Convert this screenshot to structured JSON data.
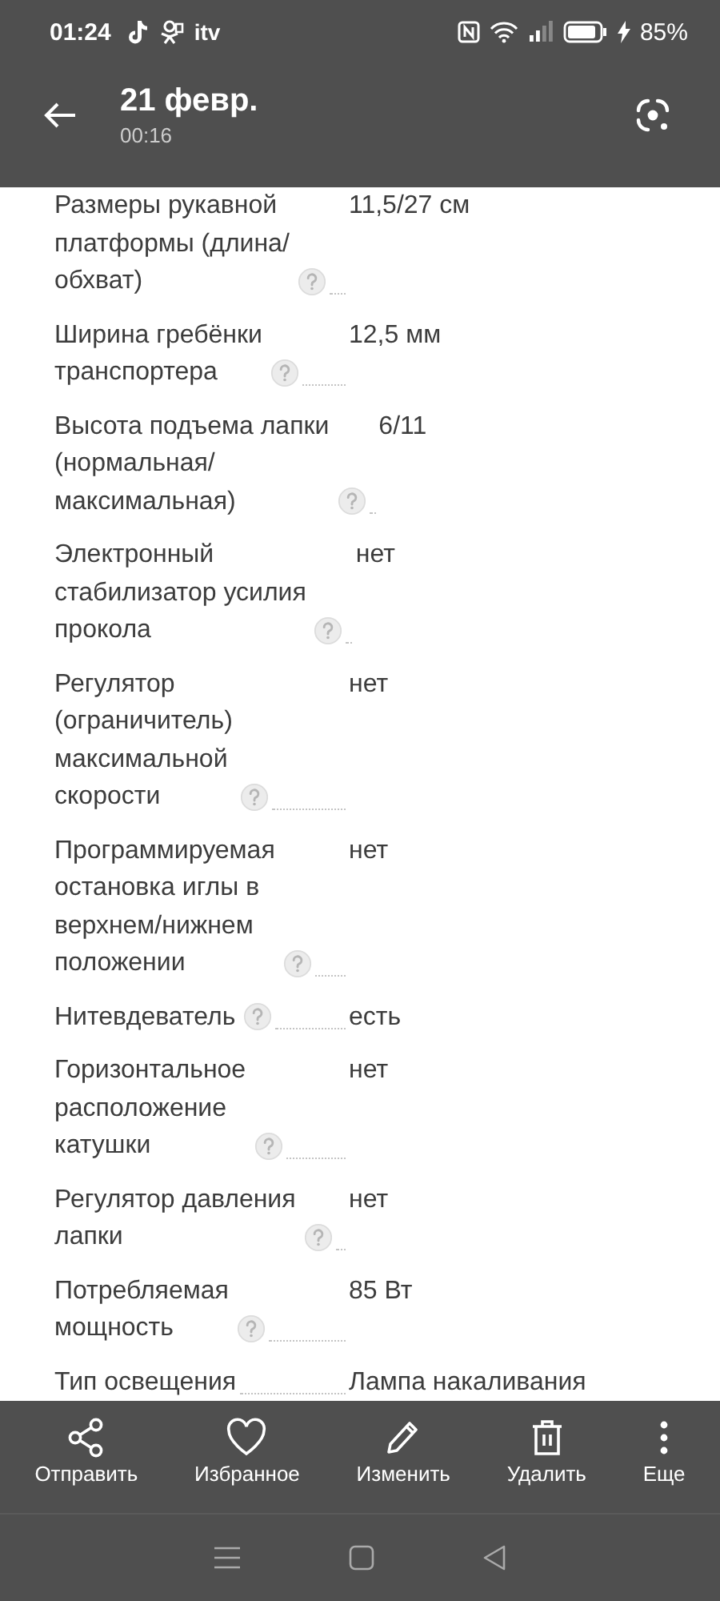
{
  "status_bar": {
    "time": "01:24",
    "app_label": "itv",
    "battery": "85%"
  },
  "toolbar": {
    "title": "21 февр.",
    "subtitle": "00:16"
  },
  "specs": [
    {
      "label": "Размеры рукавной\nплатформы (длина/\nобхват)",
      "help": true,
      "value": "11,5/27 см"
    },
    {
      "label": "Ширина гребёнки\nтранспортера",
      "help": true,
      "value": "12,5 мм"
    },
    {
      "label": "Высота подъема лапки\n(нормальная/\nмаксимальная)",
      "help": true,
      "value": "6/11"
    },
    {
      "label": "Электронный\nстабилизатор усилия\nпрокола",
      "help": true,
      "value": "нет"
    },
    {
      "label": "Регулятор\n(ограничитель)\nмаксимальной\nскорости",
      "help": true,
      "value": "нет"
    },
    {
      "label": "Программируемая\nостановка иглы в\nверхнем/нижнем\nположении",
      "help": true,
      "value": "нет"
    },
    {
      "label": "Нитевдеватель",
      "help": true,
      "value": "есть"
    },
    {
      "label": "Горизонтальное\nрасположение\nкатушки",
      "help": true,
      "value": "нет"
    },
    {
      "label": "Регулятор давления\nлапки",
      "help": true,
      "value": "нет"
    },
    {
      "label": "Потребляемая\nмощность",
      "help": true,
      "value": "85 Вт"
    },
    {
      "label": "Тип освещения",
      "help": false,
      "value": "Лампа накаливания"
    }
  ],
  "actions": [
    {
      "kind": "share",
      "label": "Отправить"
    },
    {
      "kind": "favorite",
      "label": "Избранное"
    },
    {
      "kind": "edit",
      "label": "Изменить"
    },
    {
      "kind": "delete",
      "label": "Удалить"
    },
    {
      "kind": "more",
      "label": "Еще"
    }
  ]
}
